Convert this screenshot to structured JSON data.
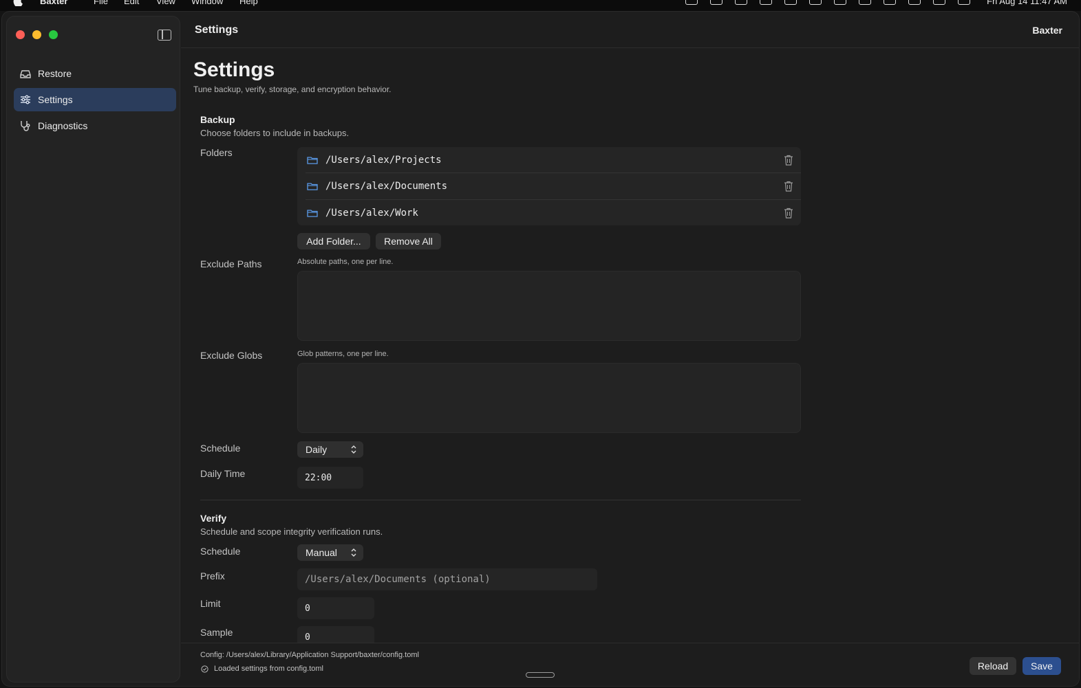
{
  "menubar": {
    "app_name": "Baxter",
    "menus": [
      "File",
      "Edit",
      "View",
      "Window",
      "Help"
    ],
    "clock": "Fri Aug 14  11:47 AM"
  },
  "window": {
    "title": "Settings",
    "app_label": "Baxter"
  },
  "sidebar": {
    "items": [
      {
        "label": "Restore",
        "icon": "restore-icon",
        "active": false
      },
      {
        "label": "Settings",
        "icon": "sliders-icon",
        "active": true
      },
      {
        "label": "Diagnostics",
        "icon": "stethoscope-icon",
        "active": false
      }
    ]
  },
  "page": {
    "title": "Settings",
    "subtitle": "Tune backup, verify, storage, and encryption behavior."
  },
  "backup": {
    "title": "Backup",
    "description": "Choose folders to include in backups.",
    "folders_label": "Folders",
    "folders": [
      "/Users/alex/Projects",
      "/Users/alex/Documents",
      "/Users/alex/Work"
    ],
    "add_folder_label": "Add Folder...",
    "remove_all_label": "Remove All",
    "exclude_paths_label": "Exclude Paths",
    "exclude_paths_hint": "Absolute paths, one per line.",
    "exclude_paths_value": "",
    "exclude_globs_label": "Exclude Globs",
    "exclude_globs_hint": "Glob patterns, one per line.",
    "exclude_globs_value": "",
    "schedule_label": "Schedule",
    "schedule_value": "Daily",
    "daily_time_label": "Daily Time",
    "daily_time_value": "22:00"
  },
  "verify": {
    "title": "Verify",
    "description": "Schedule and scope integrity verification runs.",
    "schedule_label": "Schedule",
    "schedule_value": "Manual",
    "prefix_label": "Prefix",
    "prefix_placeholder": "/Users/alex/Documents (optional)",
    "limit_label": "Limit",
    "limit_value": "0",
    "sample_label": "Sample",
    "sample_value": "0"
  },
  "footer": {
    "config_path": "Config: /Users/alex/Library/Application Support/baxter/config.toml",
    "status": "Loaded settings from config.toml",
    "reload_label": "Reload",
    "save_label": "Save"
  },
  "colors": {
    "accent": "#2c4f8f",
    "sidebar_active": "#2b3d5c",
    "folder_icon": "#5b9bea"
  }
}
